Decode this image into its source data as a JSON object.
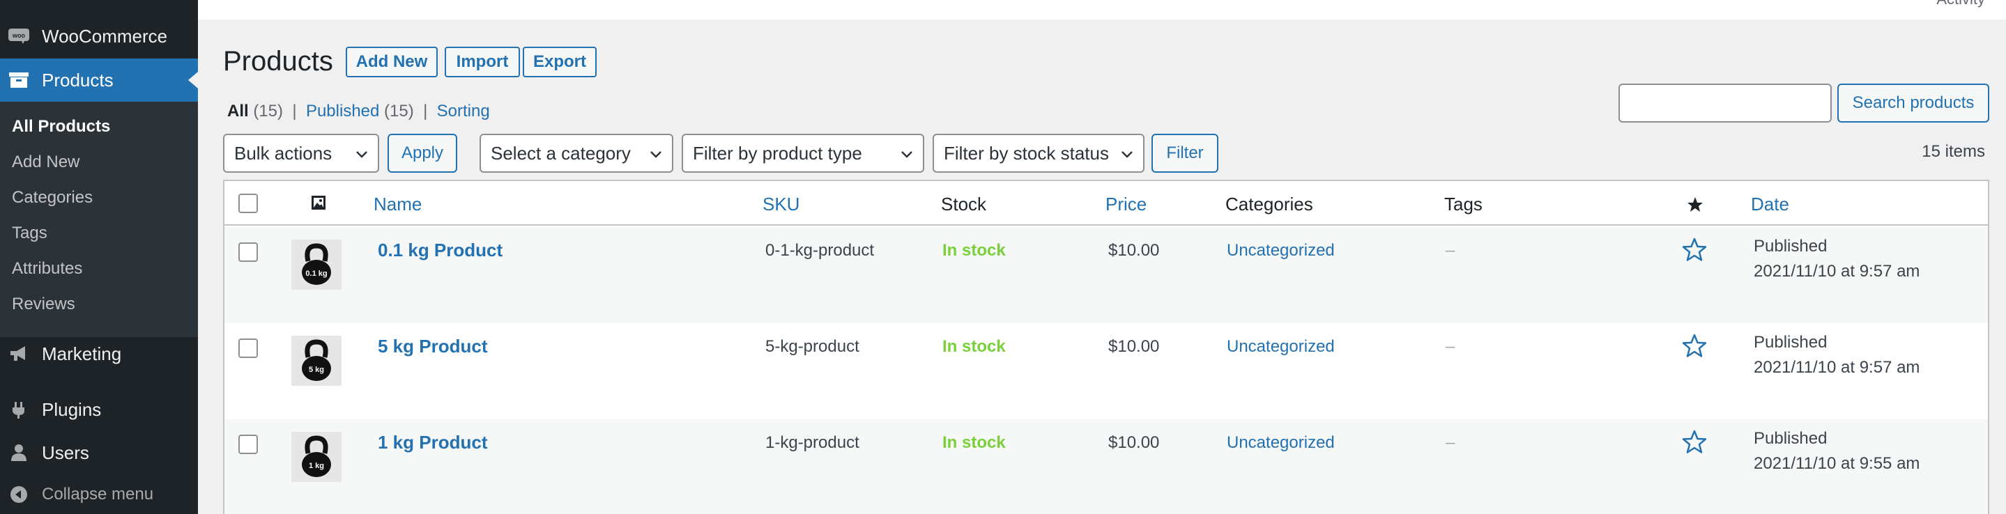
{
  "topbar": {
    "activity": "Activity"
  },
  "sidebar": {
    "woocommerce": "WooCommerce",
    "products": "Products",
    "submenu": [
      "All Products",
      "Add New",
      "Categories",
      "Tags",
      "Attributes",
      "Reviews"
    ],
    "marketing": "Marketing",
    "plugins": "Plugins",
    "users": "Users",
    "collapse": "Collapse menu"
  },
  "header": {
    "title": "Products",
    "add_new": "Add New",
    "import": "Import",
    "export": "Export"
  },
  "views": {
    "all_label": "All",
    "all_count": "(15)",
    "published_label": "Published",
    "published_count": "(15)",
    "sorting_label": "Sorting",
    "separator": "|"
  },
  "search": {
    "value": "",
    "button": "Search products"
  },
  "filters": {
    "bulk_actions": "Bulk actions",
    "apply": "Apply",
    "category": "Select a category",
    "product_type": "Filter by product type",
    "stock_status": "Filter by stock status",
    "filter": "Filter",
    "items_count": "15 items"
  },
  "table": {
    "columns": {
      "name": "Name",
      "sku": "SKU",
      "stock": "Stock",
      "price": "Price",
      "categories": "Categories",
      "tags": "Tags",
      "date": "Date"
    },
    "rows": [
      {
        "thumb_label": "0.1 kg",
        "name": "0.1 kg Product",
        "sku": "0-1-kg-product",
        "stock": "In stock",
        "price": "$10.00",
        "category": "Uncategorized",
        "tags": "–",
        "date_status": "Published",
        "date_value": "2021/11/10 at 9:57 am"
      },
      {
        "thumb_label": "5 kg",
        "name": "5 kg Product",
        "sku": "5-kg-product",
        "stock": "In stock",
        "price": "$10.00",
        "category": "Uncategorized",
        "tags": "–",
        "date_status": "Published",
        "date_value": "2021/11/10 at 9:57 am"
      },
      {
        "thumb_label": "1 kg",
        "name": "1 kg Product",
        "sku": "1-kg-product",
        "stock": "In stock",
        "price": "$10.00",
        "category": "Uncategorized",
        "tags": "–",
        "date_status": "Published",
        "date_value": "2021/11/10 at 9:55 am"
      }
    ]
  },
  "colors": {
    "sidebar_bg": "#1d2327",
    "submenu_bg": "#2c3338",
    "accent": "#2271b1",
    "in_stock": "#7ad03a",
    "page_bg": "#f0f0f1"
  }
}
